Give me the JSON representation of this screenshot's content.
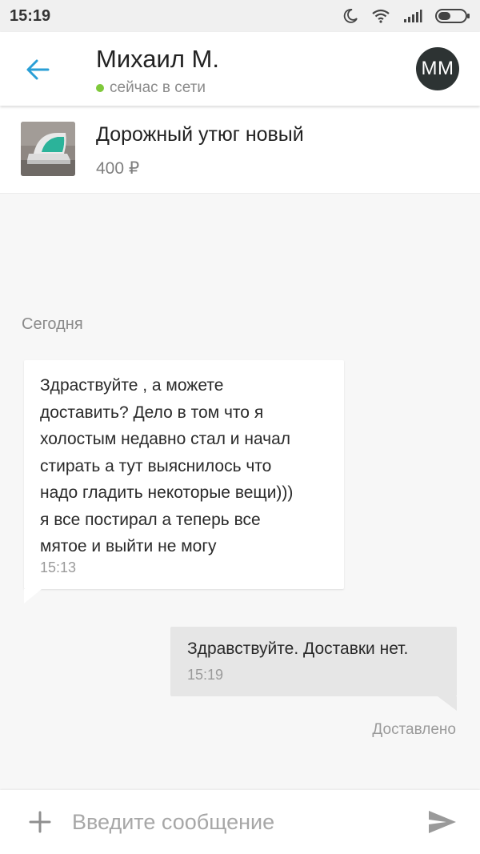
{
  "status_bar": {
    "time": "15:19",
    "icons": [
      "moon-icon",
      "wifi-icon",
      "signal-icon",
      "battery-icon"
    ]
  },
  "header": {
    "back_icon": "arrow-left-icon",
    "contact_name": "Михаил М.",
    "online_status": "сейчас в сети",
    "avatar_initials": "ММ",
    "colors": {
      "accent": "#2a9fd6",
      "online": "#7fc93b",
      "avatar_bg": "#2d3333"
    }
  },
  "listing": {
    "title": "Дорожный утюг новый",
    "price": "400 ₽",
    "thumbnail": "iron-photo"
  },
  "chat": {
    "date_label": "Сегодня",
    "messages": [
      {
        "direction": "incoming",
        "text": "Здраствуйте , а можете\nдоставить? Дело в том что я\nхолостым недавно стал и начал\nстирать а тут выяснилось что\nнадо гладить некоторые вещи)))\nя все постирал а теперь все\nмятое и выйти не могу",
        "time": "15:13"
      },
      {
        "direction": "outgoing",
        "text": "Здравствуйте. Доставки нет.",
        "time": "15:19"
      }
    ],
    "delivery_status": "Доставлено"
  },
  "composer": {
    "attach_icon": "plus-icon",
    "placeholder": "Введите сообщение",
    "value": "",
    "send_icon": "send-icon"
  }
}
